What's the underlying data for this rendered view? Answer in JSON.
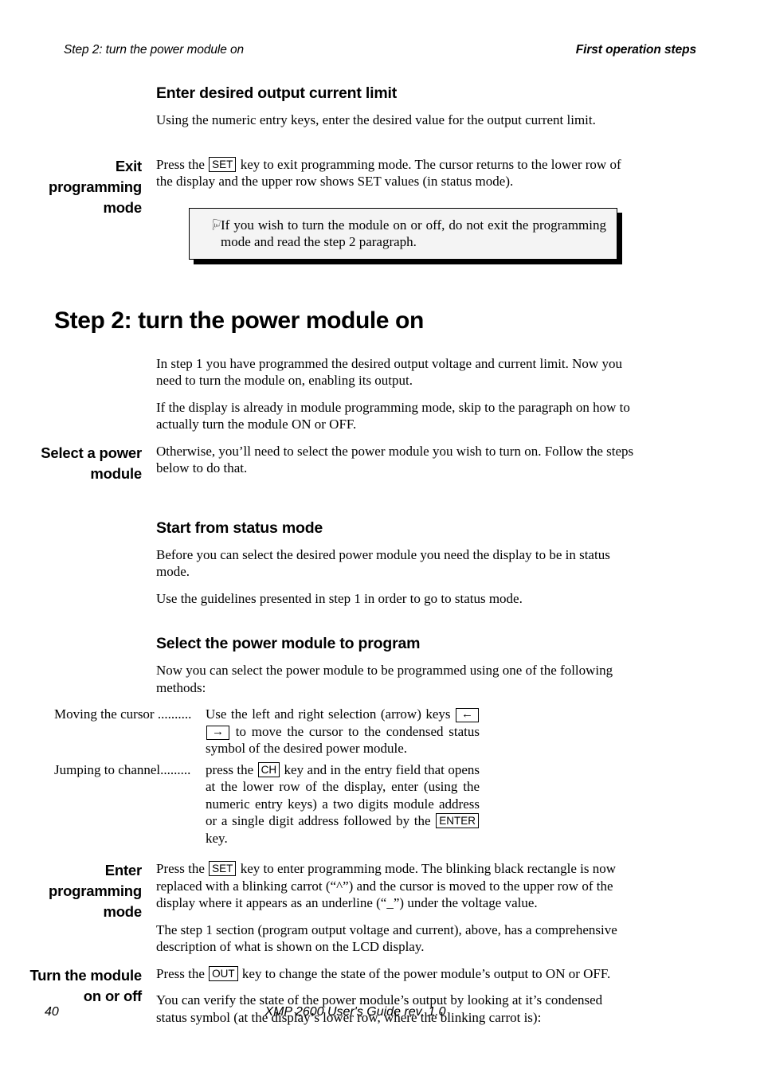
{
  "running_head": {
    "left": "Step 2: turn the power module on",
    "right": "First operation steps"
  },
  "sections": {
    "enter_limit": {
      "heading": "Enter desired output current limit",
      "paragraph": "Using the numeric entry keys, enter the desired value for the output current limit."
    },
    "exit_programming": {
      "margin_heading": "Exit programming mode",
      "text_before_key": "Press the ",
      "key": "SET",
      "text_after_key": " key to exit programming mode. The cursor returns to the lower row of the display and the upper row shows SET values (in status mode)."
    },
    "note": {
      "icon": "pointing-hand-icon",
      "icon_glyph": "☟",
      "text": "If you wish to turn the module on or off, do not exit the programming mode and read the step 2 paragraph."
    },
    "step2": {
      "heading": "Step 2: turn the power module on",
      "paragraph_1": "In step 1 you have programmed the desired output voltage and current limit. Now you need to turn the module on, enabling its output.",
      "paragraph_2": "If the display is already in module programming mode, skip to the paragraph on how to actually turn the module ON or OFF."
    },
    "select_module": {
      "margin_heading": "Select a power module",
      "paragraph": "Otherwise, you’ll need to select the power module you wish to turn on. Follow the steps below to do that."
    },
    "status_mode": {
      "heading": "Start from status mode",
      "paragraph_1": "Before you can select the desired power module you need the display to be in status mode.",
      "paragraph_2": "Use the guidelines presented in step 1 in order to go to status mode."
    },
    "select_to_program": {
      "heading": "Select the power module to program",
      "intro": "Now you can select the power module to be programmed using one of the following methods:",
      "items": [
        {
          "term": "Moving the cursor ..........",
          "desc_1": "Use the left and right selection (arrow) keys ",
          "key_1": "←",
          "key_2": "→",
          "desc_2": " to move the cursor to the condensed status symbol of the desired power module."
        },
        {
          "term": "Jumping to channel.........",
          "desc_1": "press the ",
          "key_1": "CH",
          "desc_2": " key and in the entry field that opens at the lower row of the display, enter (using the numeric entry keys) a two digits module address or a single digit address followed by the ",
          "key_2": "ENTER",
          "desc_3": " key."
        }
      ]
    },
    "enter_programming": {
      "margin_heading": "Enter programming mode",
      "text_before_key": "Press the ",
      "key": "SET",
      "text_after_key": " key to enter programming mode. The blinking black rectangle is now replaced with a blinking carrot (“^”) and the cursor is moved to the upper row of the display where it appears as an underline (“_”) under the voltage value.",
      "paragraph_2": "The step 1 section (program output voltage and current), above, has a comprehensive description of what is shown on the LCD display."
    },
    "turn_module": {
      "margin_heading": "Turn the module on or off",
      "text_before_key": "Press the ",
      "key": "OUT",
      "text_after_key": " key to change the state of the power module’s output to ON or OFF.",
      "paragraph_2": "You can verify the state of the power module’s output by looking at it’s condensed status symbol (at the display’s lower row, where the blinking carrot is):"
    }
  },
  "footer": {
    "page_number": "40",
    "title": "XMP 2600 User's Guide rev. 1.0"
  }
}
